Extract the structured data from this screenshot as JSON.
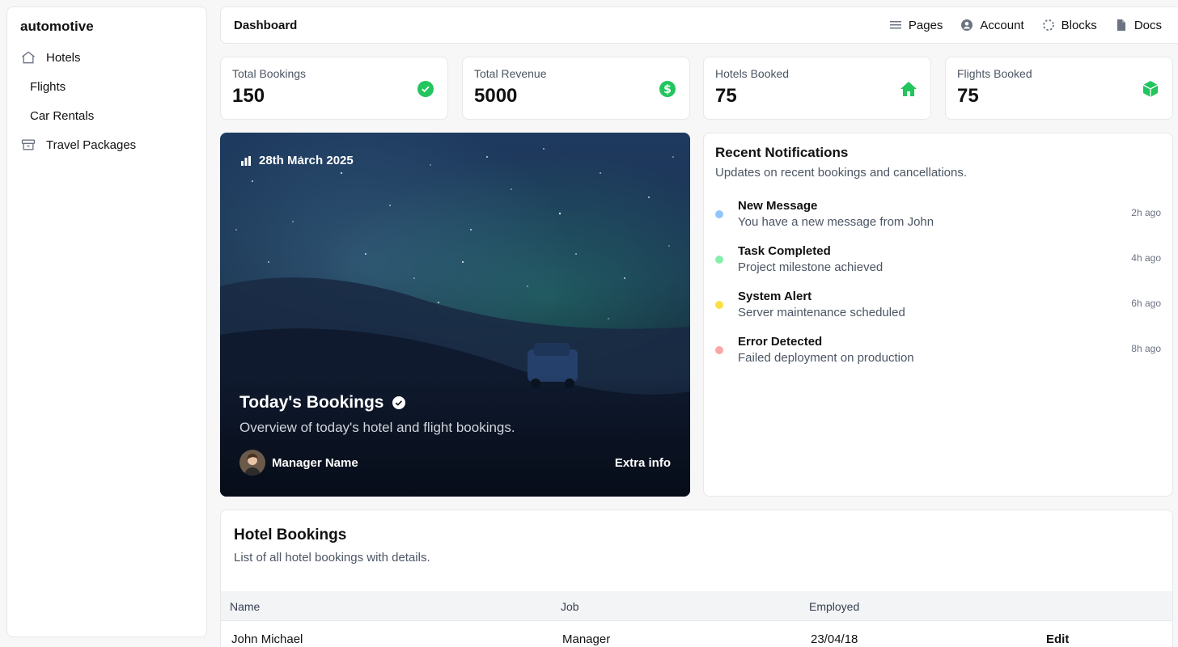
{
  "sidebar": {
    "brand": "automotive",
    "items": [
      {
        "label": "Hotels",
        "icon": "home-icon"
      },
      {
        "label": "Flights"
      },
      {
        "label": "Car Rentals"
      },
      {
        "label": "Travel Packages",
        "icon": "archive-box-icon"
      }
    ]
  },
  "topbar": {
    "title": "Dashboard",
    "links": [
      {
        "label": "Pages",
        "icon": "list-icon"
      },
      {
        "label": "Account",
        "icon": "user-circle-icon"
      },
      {
        "label": "Blocks",
        "icon": "dashed-circle-icon"
      },
      {
        "label": "Docs",
        "icon": "document-icon"
      }
    ]
  },
  "stats": [
    {
      "label": "Total Bookings",
      "value": "150",
      "icon": "check-circle-icon"
    },
    {
      "label": "Total Revenue",
      "value": "5000",
      "icon": "dollar-circle-icon"
    },
    {
      "label": "Hotels Booked",
      "value": "75",
      "icon": "house-icon"
    },
    {
      "label": "Flights Booked",
      "value": "75",
      "icon": "cube-icon"
    }
  ],
  "hero": {
    "date": "28th March 2025",
    "title": "Today's Bookings",
    "subtitle": "Overview of today's hotel and flight bookings.",
    "manager": "Manager Name",
    "extra": "Extra info"
  },
  "notifications": {
    "title": "Recent Notifications",
    "subtitle": "Updates on recent bookings and cancellations.",
    "items": [
      {
        "title": "New Message",
        "desc": "You have a new message from John",
        "time": "2h ago",
        "color": "#93c5fd"
      },
      {
        "title": "Task Completed",
        "desc": "Project milestone achieved",
        "time": "4h ago",
        "color": "#86efac"
      },
      {
        "title": "System Alert",
        "desc": "Server maintenance scheduled",
        "time": "6h ago",
        "color": "#fde047"
      },
      {
        "title": "Error Detected",
        "desc": "Failed deployment on production",
        "time": "8h ago",
        "color": "#fca5a5"
      }
    ]
  },
  "bookings": {
    "title": "Hotel Bookings",
    "subtitle": "List of all hotel bookings with details.",
    "columns": [
      "Name",
      "Job",
      "Employed"
    ],
    "rows": [
      {
        "name": "John Michael",
        "job": "Manager",
        "employed": "23/04/18",
        "action": "Edit"
      }
    ]
  },
  "colors": {
    "accent": "#22c55e"
  }
}
